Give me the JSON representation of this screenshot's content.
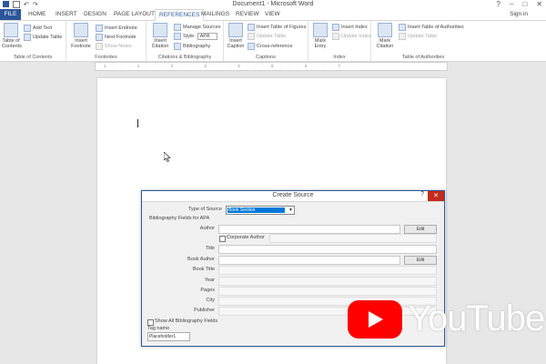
{
  "window": {
    "title": "Document1 - Microsoft Word"
  },
  "tabs": [
    "FILE",
    "HOME",
    "INSERT",
    "DESIGN",
    "PAGE LAYOUT",
    "REFERENCES",
    "MAILINGS",
    "REVIEW",
    "VIEW"
  ],
  "signin": "Sign in",
  "ribbon": {
    "toc": {
      "btn1": "Table of",
      "btn2": "Contents",
      "add_text": "Add Text",
      "update_table": "Update Table",
      "label": "Table of Contents"
    },
    "footnotes": {
      "insert1": "Insert",
      "insert2": "Footnote",
      "insert_endnote": "Insert Endnote",
      "next_footnote": "Next Footnote",
      "show_notes": "Show Notes",
      "label": "Footnotes"
    },
    "citations": {
      "insert1": "Insert",
      "insert2": "Citation",
      "manage_sources": "Manage Sources",
      "style": "Style:",
      "style_value": "APA",
      "bibliography": "Bibliography",
      "label": "Citations & Bibliography"
    },
    "captions": {
      "insert1": "Insert",
      "insert2": "Caption",
      "insert_tof": "Insert Table of Figures",
      "update_table": "Update Table",
      "cross_ref": "Cross-reference",
      "label": "Captions"
    },
    "index": {
      "mark1": "Mark",
      "mark2": "Entry",
      "insert_index": "Insert Index",
      "update_index": "Update Index",
      "label": "Index"
    },
    "toa": {
      "mark1": "Mark",
      "mark2": "Citation",
      "insert_toa": "Insert Table of Authorities",
      "update_table": "Update Table",
      "label": "Table of Authorities"
    }
  },
  "ruler": {
    "marks": "· 1 · · · 1 · · · 2 · · · 3 · · · 4 · · · 5 · · · 6 · · · 7 · ·"
  },
  "dialog": {
    "title": "Create Source",
    "help": "?",
    "close": "✕",
    "type_label": "Type of Source",
    "type_value": "Book Section",
    "section_header": "Bibliography Fields for APA",
    "author_label": "Author",
    "edit_label": "Edit",
    "corporate_author": "Corporate Author",
    "title_label": "Title",
    "book_author_label": "Book Author",
    "book_title_label": "Book Title",
    "year_label": "Year",
    "pages_label": "Pages",
    "city_label": "City",
    "publisher_label": "Publisher",
    "show_all": "Show All Bibliography Fields",
    "tag_label": "Tag name",
    "tag_value": "Placeholder1"
  },
  "youtube": {
    "text": "YouTube"
  }
}
